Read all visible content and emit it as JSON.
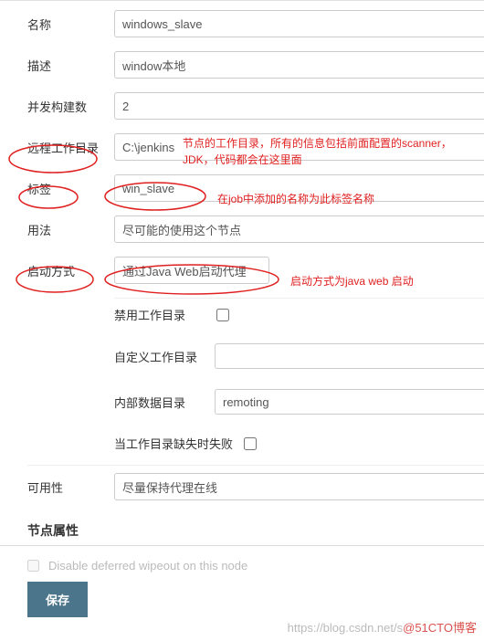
{
  "fields": {
    "name": {
      "label": "名称",
      "value": "windows_slave"
    },
    "desc": {
      "label": "描述",
      "value": "window本地"
    },
    "executors": {
      "label": "并发构建数",
      "value": "2"
    },
    "remote_root": {
      "label": "远程工作目录",
      "value": "C:\\jenkins"
    },
    "labels": {
      "label": "标签",
      "value": "win_slave"
    },
    "usage": {
      "label": "用法",
      "value": "尽可能的使用这个节点"
    },
    "launch": {
      "label": "启动方式",
      "value": "通过Java Web启动代理"
    },
    "availability": {
      "label": "可用性",
      "value": "尽量保持代理在线"
    }
  },
  "sub": {
    "disable_workdir": {
      "label": "禁用工作目录"
    },
    "custom_workdir": {
      "label": "自定义工作目录",
      "value": ""
    },
    "internal_dir": {
      "label": "内部数据目录",
      "value": "remoting"
    },
    "fail_if_missing": {
      "label": "当工作目录缺失时失败"
    }
  },
  "annotations": {
    "remote_root_note": "节点的工作目录，所有的信息包括前面配置的scanner，JDK，代码都会在这里面",
    "labels_note": "在job中添加的名称为此标签名称",
    "launch_note": "启动方式为java web 启动"
  },
  "section": {
    "node_props": "节点属性",
    "disabled_option": "Disable deferred wipeout on this node"
  },
  "buttons": {
    "save": "保存"
  },
  "watermark": {
    "gray": "https://blog.csdn.net/s",
    "red": "@51CTO博客"
  }
}
